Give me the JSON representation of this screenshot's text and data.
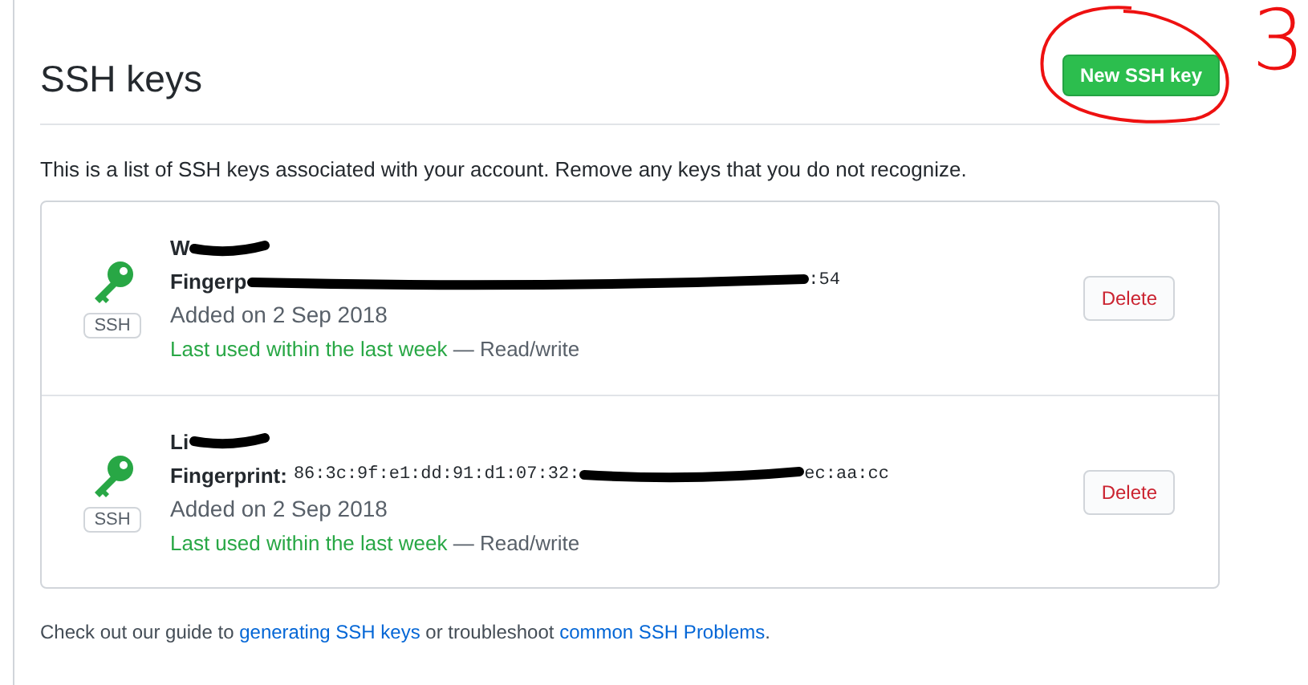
{
  "header": {
    "title": "SSH keys",
    "new_button": "New SSH key"
  },
  "annotation": {
    "label": "3"
  },
  "description": "This is a list of SSH keys associated with your account. Remove any keys that you do not recognize.",
  "keys": [
    {
      "title": "W",
      "badge": "SSH",
      "fingerprint_label": "Fingerp",
      "fingerprint_end": ":54",
      "added": "Added on 2 Sep 2018",
      "last_used": "Last used within the last week",
      "access": "— Read/write",
      "delete": "Delete"
    },
    {
      "title": "Li",
      "badge": "SSH",
      "fingerprint_label": "Fingerprint:",
      "fingerprint_start": "86:3c:9f:e1:dd:91:d1:07:32:",
      "fingerprint_end": "ec:aa:cc",
      "added": "Added on 2 Sep 2018",
      "last_used": "Last used within the last week",
      "access": "— Read/write",
      "delete": "Delete"
    }
  ],
  "footer": {
    "before": "Check out our guide to",
    "link1": "generating SSH keys",
    "middle": "or troubleshoot",
    "link2": "common SSH Problems",
    "after": "."
  }
}
